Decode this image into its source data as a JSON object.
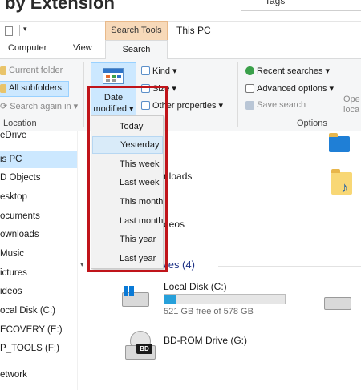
{
  "background": {
    "heading": "by Extension",
    "tags_label": "Tags"
  },
  "titlebar": {
    "context_tab_group": "Search Tools",
    "window_title": "This PC"
  },
  "tabs": {
    "computer": "Computer",
    "view": "View",
    "search": "Search"
  },
  "ribbon": {
    "location": {
      "current_folder": "Current folder",
      "all_subfolders": "All subfolders",
      "search_again_in": "Search again in",
      "group_label": "Location"
    },
    "refine": {
      "date_modified_line1": "Date",
      "date_modified_line2": "modified",
      "kind": "Kind",
      "size": "Size",
      "other_properties": "Other properties"
    },
    "options": {
      "recent_searches": "Recent searches",
      "advanced_options": "Advanced options",
      "save_search": "Save search",
      "open_location_line1": "Ope",
      "open_location_line2": "loca",
      "group_label": "Options"
    }
  },
  "date_dropdown": {
    "items": [
      "Today",
      "Yesterday",
      "This week",
      "Last week",
      "This month",
      "Last month",
      "This year",
      "Last year"
    ],
    "hovered": "Yesterday"
  },
  "nav": {
    "items": [
      "eDrive",
      "is PC",
      "D Objects",
      "esktop",
      "ocuments",
      "ownloads",
      "Music",
      "ictures",
      "ideos",
      "ocal Disk (C:)",
      "ECOVERY (E:)",
      "P_TOOLS (F:)",
      "etwork"
    ],
    "selected": "is PC"
  },
  "main": {
    "folder_partial_downloads": "nloads",
    "folder_partial_videos": "deos",
    "devices_heading": "rives (4)",
    "local_disk": {
      "name": "Local Disk (C:)",
      "free_text": "521 GB free of 578 GB",
      "used_fraction": 0.1
    },
    "bd_rom": {
      "name": "BD-ROM Drive (G:)",
      "badge": "BD"
    }
  },
  "colors": {
    "accent_selected": "#cce8ff",
    "context_tab": "#f7d9b9",
    "annotation_red": "#c0141a",
    "disk_bar": "#26a0da"
  }
}
